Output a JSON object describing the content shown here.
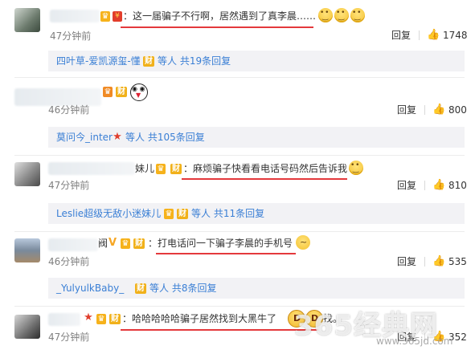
{
  "comments": [
    {
      "text": "：这一届骗子不行啊，居然遇到了真李晨……",
      "time": "47分钟前",
      "reply_label": "回复",
      "likes": "1748",
      "replies_summary": {
        "name": "四叶草-爱凯源玺-懂",
        "tail": "等人 共19条回复"
      }
    },
    {
      "text": "",
      "time": "46分钟前",
      "reply_label": "回复",
      "likes": "800",
      "replies_summary": {
        "name": "莫问今_inter",
        "tail": "等人 共105条回复"
      }
    },
    {
      "name_suffix": "妹儿",
      "text": "：麻烦骗子快看看电话号码然后告诉我",
      "time": "47分钟前",
      "reply_label": "回复",
      "likes": "810",
      "replies_summary": {
        "name": "Leslie超级无敌小迷妹儿",
        "tail": "等人 共11条回复"
      }
    },
    {
      "name_suffix": "阀",
      "text": "：打电话问一下骗子李晨的手机号",
      "time": "46分钟前",
      "reply_label": "回复",
      "likes": "535",
      "replies_summary": {
        "name": "_YulyulkBaby_",
        "tail": "等人 共8条回复"
      }
    },
    {
      "text": "：哈哈哈哈哈骗子居然找到大黑牛了",
      "text_tail": "找。",
      "time": "47分钟前",
      "reply_label": "回复",
      "likes": "352"
    }
  ],
  "badges": {
    "cai": "财",
    "vip": "♛",
    "v": "V",
    "star": "★",
    "red": "¥"
  },
  "icons": {
    "like": "thumbs-up-icon"
  },
  "watermark": {
    "text": "365经典网",
    "url": "www.365jd.com"
  },
  "colors": {
    "underline": "#e4393c",
    "link": "#3a7fd5",
    "reply_bg": "#f2f2f5"
  }
}
